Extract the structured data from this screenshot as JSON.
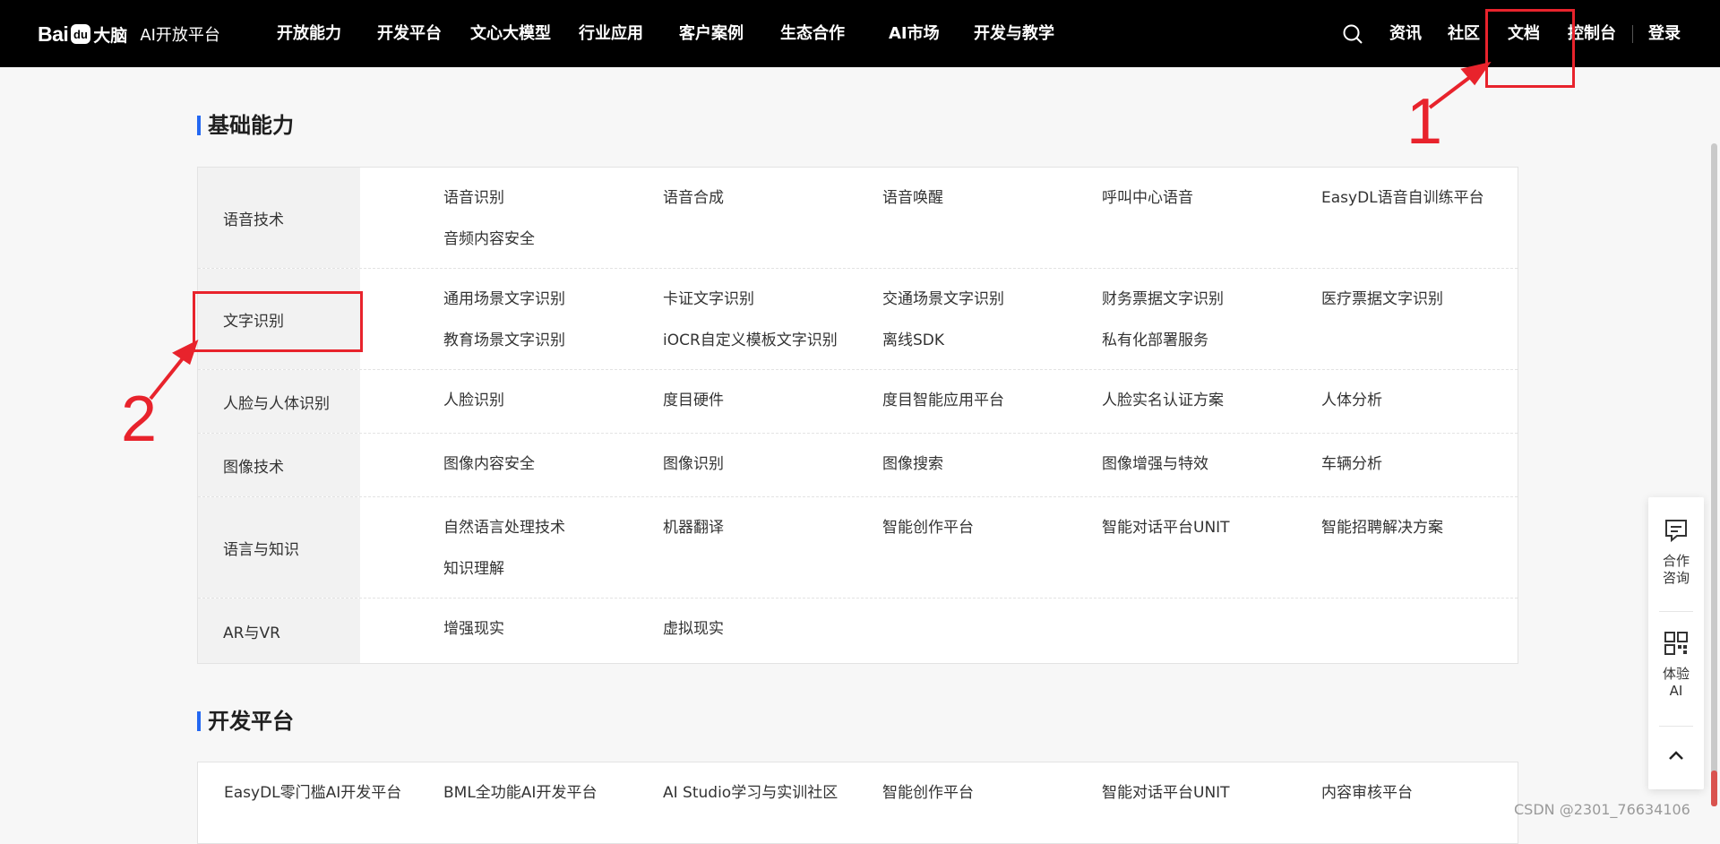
{
  "header": {
    "logo_text": "Bai",
    "logo_brain": "大脑",
    "platform": "AI开放平台",
    "nav": [
      "开放能力",
      "开发平台",
      "文心大模型",
      "行业应用",
      "客户案例",
      "生态合作",
      "AI市场",
      "开发与教学"
    ],
    "right": {
      "search_icon": "search-icon",
      "news": "资讯",
      "community": "社区",
      "docs": "文档",
      "console": "控制台",
      "login": "登录"
    }
  },
  "sections": {
    "basic": "基础能力",
    "dev": "开发平台"
  },
  "capabilities": [
    {
      "category": "语音技术",
      "items": [
        "语音识别",
        "语音合成",
        "语音唤醒",
        "呼叫中心语音",
        "EasyDL语音自训练平台",
        "音频内容安全"
      ]
    },
    {
      "category": "文字识别",
      "items": [
        "通用场景文字识别",
        "卡证文字识别",
        "交通场景文字识别",
        "财务票据文字识别",
        "医疗票据文字识别",
        "教育场景文字识别",
        "iOCR自定义模板文字识别",
        "离线SDK",
        "私有化部署服务"
      ]
    },
    {
      "category": "人脸与人体识别",
      "items": [
        "人脸识别",
        "度目硬件",
        "度目智能应用平台",
        "人脸实名认证方案",
        "人体分析"
      ]
    },
    {
      "category": "图像技术",
      "items": [
        "图像内容安全",
        "图像识别",
        "图像搜索",
        "图像增强与特效",
        "车辆分析"
      ]
    },
    {
      "category": "语言与知识",
      "items": [
        "自然语言处理技术",
        "机器翻译",
        "智能创作平台",
        "智能对话平台UNIT",
        "智能招聘解决方案",
        "知识理解"
      ]
    },
    {
      "category": "AR与VR",
      "items": [
        "增强现实",
        "虚拟现实"
      ]
    }
  ],
  "dev_platform": [
    "EasyDL零门槛AI开发平台",
    "BML全功能AI开发平台",
    "AI Studio学习与实训社区",
    "智能创作平台",
    "智能对话平台UNIT",
    "内容审核平台"
  ],
  "annotations": {
    "one": "1",
    "two": "2",
    "color": "#e8232c"
  },
  "float_panel": {
    "consult": "合作咨询",
    "consult_icon": "chat-icon",
    "try_ai": "体验AI",
    "try_icon": "qr-code-icon",
    "top_icon": "chevron-up-icon"
  },
  "watermark": "CSDN @2301_76634106"
}
